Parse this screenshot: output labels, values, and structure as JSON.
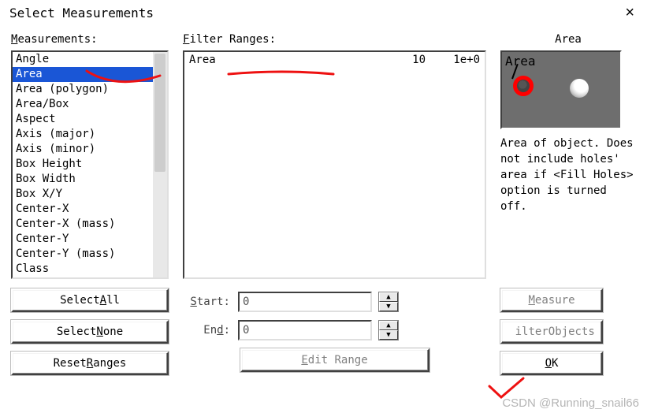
{
  "window": {
    "title": "Select Measurements",
    "close_icon": "×"
  },
  "left": {
    "label_prefix": "M",
    "label_rest": "easurements:",
    "items": [
      "Angle",
      "Area",
      "Area (polygon)",
      "Area/Box",
      "Aspect",
      "Axis (major)",
      "Axis (minor)",
      "Box Height",
      "Box Width",
      "Box X/Y",
      "Center-X",
      "Center-X (mass)",
      "Center-Y",
      "Center-Y (mass)",
      "Class"
    ],
    "selected_index": 1
  },
  "filter": {
    "label_prefix": "F",
    "label_rest": "ilter Ranges:",
    "rows": [
      {
        "name": "Area",
        "start": "10",
        "end": "1e+0"
      }
    ]
  },
  "right": {
    "heading": "Area",
    "preview_label": "Area",
    "description": "Area of object. Does not include holes' area if <Fill Holes> option is turned off."
  },
  "buttons": {
    "select_all_pre": "Select ",
    "select_all_u": "A",
    "select_all_post": "ll",
    "select_none_pre": "Select ",
    "select_none_u": "N",
    "select_none_post": "one",
    "reset_ranges_pre": "Reset ",
    "reset_ranges_u": "R",
    "reset_ranges_post": "anges",
    "edit_range_pre": "",
    "edit_range_u": "E",
    "edit_range_post": "dit Range",
    "measure_u": "M",
    "measure_post": "easure",
    "filter_objects_pre_text": "ilter ",
    "filter_objects_post": "Objects",
    "ok_u": "O",
    "ok_post": "K"
  },
  "range_form": {
    "start_u": "S",
    "start_rest": "tart:",
    "end_pre": "En",
    "end_u": "d",
    "end_post": ":",
    "start_value": "0",
    "end_value": "0"
  },
  "watermark": "CSDN @Running_snail66"
}
